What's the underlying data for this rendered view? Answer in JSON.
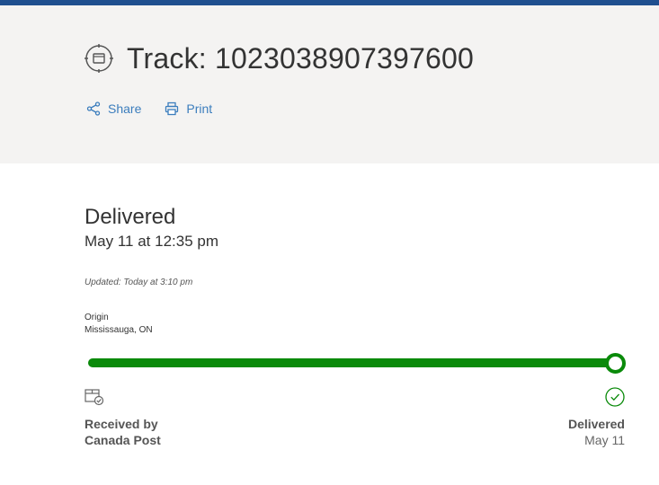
{
  "header": {
    "title": "Track: 1023038907397600",
    "title_icon": "package-target-icon",
    "actions": [
      {
        "label": "Share",
        "icon": "share-icon"
      },
      {
        "label": "Print",
        "icon": "print-icon"
      }
    ]
  },
  "summary": {
    "status": "Delivered",
    "date": "May 11 at 12:35 pm",
    "updated": "Updated: Today at 3:10 pm"
  },
  "origin": {
    "label": "Origin",
    "value": "Mississauga, ON"
  },
  "progress": {
    "fraction": 1.0,
    "color": "#0a8a0a"
  },
  "milestones": {
    "start": {
      "line1": "Received by",
      "line2": "Canada Post",
      "icon": "package-received-icon"
    },
    "end": {
      "label": "Delivered",
      "date": "May 11",
      "icon": "check-circle-icon"
    }
  },
  "colors": {
    "topbar": "#1f4f8f",
    "link": "#3b7dbd",
    "header_bg": "#f4f3f2"
  }
}
